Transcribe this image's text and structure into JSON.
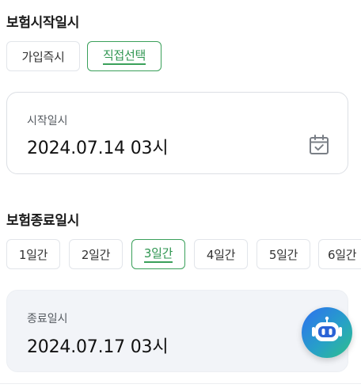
{
  "start_section": {
    "title": "보험시작일시",
    "options": [
      "가입즉시",
      "직접선택"
    ],
    "selected_index": 1,
    "card": {
      "label": "시작일시",
      "value": "2024.07.14 03시",
      "icon": "calendar-check-icon"
    }
  },
  "end_section": {
    "title": "보험종료일시",
    "options": [
      "1일간",
      "2일간",
      "3일간",
      "4일간",
      "5일간",
      "6일간"
    ],
    "selected_index": 2,
    "card": {
      "label": "종료일시",
      "value": "2024.07.17 03시"
    }
  },
  "chatbot": {
    "icon": "robot-icon"
  },
  "colors": {
    "accent": "#3aa05a",
    "border": "#e2e5ea",
    "card_grey": "#f2f4f8"
  }
}
